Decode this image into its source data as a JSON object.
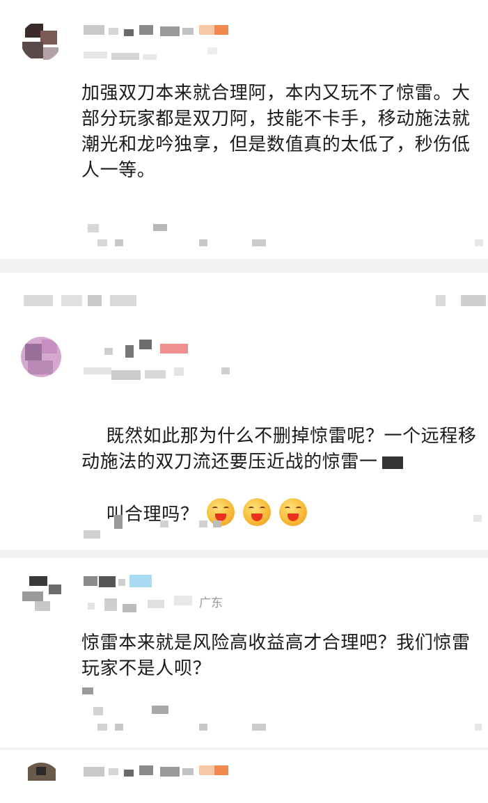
{
  "comments": [
    {
      "text": "加强双刀本来就合理阿，本内又玩不了惊雷。大部分玩家都是双刀阿，技能不卡手，移动施法就潮光和龙吟独享，但是数值真的太低了，秒伤低人一等。"
    },
    {
      "text": "既然如此那为什么不删掉惊雷呢？一个远程移动施法的双刀流还要压近战的惊雷一",
      "text2": "叫合理吗？",
      "emojis": [
        "laughing-face-emoji",
        "laughing-face-emoji",
        "laughing-face-emoji"
      ]
    },
    {
      "region": "广东",
      "text": "惊雷本来就是风险高收益高才合理吧？我们惊雷玩家不是人呗？"
    }
  ],
  "colors": {
    "text": "#1a1a1a",
    "meta": "#9a9a9a",
    "divider": "#f2f2f4"
  }
}
